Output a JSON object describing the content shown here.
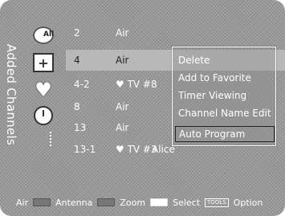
{
  "sidebar": {
    "title": "Added Channels",
    "icons": {
      "all_label": "All"
    }
  },
  "channels": [
    {
      "number": "2",
      "type": "Air",
      "name": ""
    },
    {
      "number": "4",
      "type": "Air",
      "name": ""
    },
    {
      "number": "4-2",
      "type": "♥ TV #8",
      "name": ""
    },
    {
      "number": "8",
      "type": "Air",
      "name": ""
    },
    {
      "number": "13",
      "type": "Air",
      "name": ""
    },
    {
      "number": "13-1",
      "type": "♥ TV #3",
      "name": "Alice"
    }
  ],
  "context_menu": {
    "items": [
      "Delete",
      "Add to Favorite",
      "Timer Viewing",
      "Channel Name Edit",
      "Auto Program"
    ],
    "highlighted": "Auto Program"
  },
  "footer": {
    "air": "Air",
    "antenna": "Antenna",
    "zoom": "Zoom",
    "select": "Select",
    "tools_key": "TOOLS",
    "option": "Option"
  }
}
